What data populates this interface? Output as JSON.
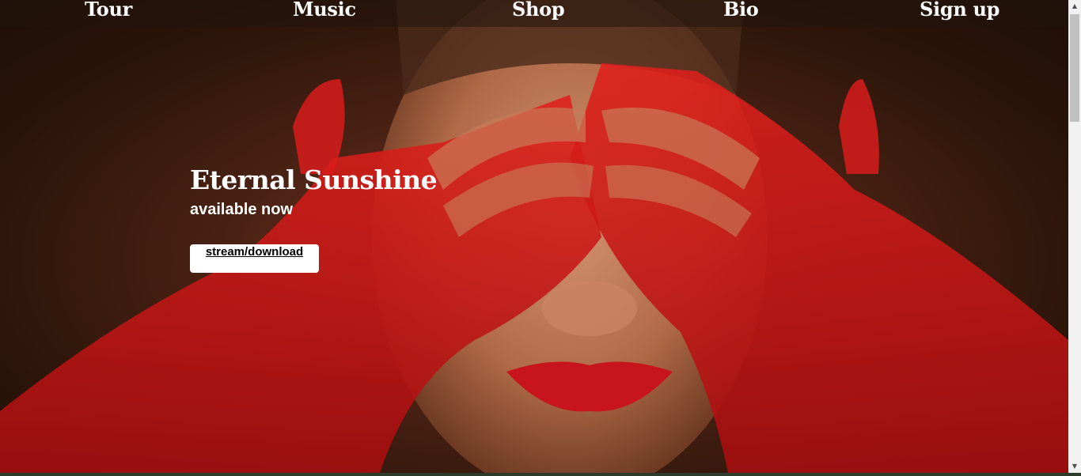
{
  "nav": {
    "items": [
      {
        "label": "Tour"
      },
      {
        "label": "Music"
      },
      {
        "label": "Shop"
      },
      {
        "label": "Bio"
      },
      {
        "label": "Sign up"
      }
    ]
  },
  "hero": {
    "title": "Eternal Sunshine",
    "subtitle": "available now",
    "cta_label": "stream/download",
    "image_icon": "album-cover-photo"
  },
  "scrollbar": {
    "up_icon": "scroll-up-arrow",
    "down_icon": "scroll-down-arrow"
  },
  "colors": {
    "nav_text": "#ffffff",
    "hero_text": "#ffffff",
    "button_bg": "#ffffff",
    "button_text": "#000000",
    "accent_red": "#c81818"
  }
}
